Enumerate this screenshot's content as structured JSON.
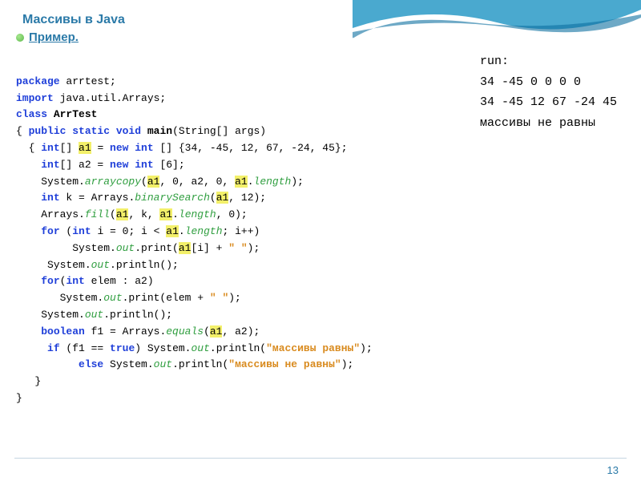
{
  "title": "Массивы в Java",
  "subtitle": "Пример.",
  "output": {
    "l1": "run:",
    "l2": "34 -45 0 0 0 0",
    "l3": "34 -45 12 67 -24 45",
    "l4": "массивы не равны"
  },
  "code": {
    "l01a": "package",
    "l01b": " arrtest;",
    "l02a": "import",
    "l02b": " java.util.Arrays;",
    "l03a": "class ",
    "l03b": "ArrTest",
    "l04a": "{ ",
    "l04b": "public static void",
    "l04c": " ",
    "l04d": "main",
    "l04e": "(String[] args)",
    "l05a": "  { ",
    "l05b": "int",
    "l05c": "[] ",
    "l05d": "a1",
    "l05e": " = ",
    "l05f": "new int",
    "l05g": " [] {34, -45, 12, 67, -24, 45};",
    "l06a": "    ",
    "l06b": "int",
    "l06c": "[] a2 = ",
    "l06d": "new int",
    "l06e": " [6];",
    "l07a": "    System.",
    "l07b": "arraycopy",
    "l07c": "(",
    "l07d": "a1",
    "l07e": ", 0, a2, 0, ",
    "l07f": "a1",
    "l07g": ".",
    "l07h": "length",
    "l07i": ");",
    "l08a": "    ",
    "l08b": "int",
    "l08c": " k = Arrays.",
    "l08d": "binarySearch",
    "l08e": "(",
    "l08f": "a1",
    "l08g": ", 12);",
    "l09a": "    Arrays.",
    "l09b": "fill",
    "l09c": "(",
    "l09d": "a1",
    "l09e": ", k, ",
    "l09f": "a1",
    "l09g": ".",
    "l09h": "length",
    "l09i": ", 0);",
    "l10a": "    ",
    "l10b": "for",
    "l10c": " (",
    "l10d": "int",
    "l10e": " i = 0; i < ",
    "l10f": "a1",
    "l10g": ".",
    "l10h": "length",
    "l10i": "; i++)",
    "l11a": "         System.",
    "l11b": "out",
    "l11c": ".print(",
    "l11d": "a1",
    "l11e": "[i] + ",
    "l11f": "\" \"",
    "l11g": ");",
    "l12a": "     System.",
    "l12b": "out",
    "l12c": ".println();",
    "l13a": "    ",
    "l13b": "for",
    "l13c": "(",
    "l13d": "int",
    "l13e": " elem : a2)",
    "l14a": "       System.",
    "l14b": "out",
    "l14c": ".print(elem + ",
    "l14d": "\" \"",
    "l14e": ");",
    "l15a": "    System.",
    "l15b": "out",
    "l15c": ".println();",
    "l16a": "    ",
    "l16b": "boolean",
    "l16c": " f1 = Arrays.",
    "l16d": "equals",
    "l16e": "(",
    "l16f": "a1",
    "l16g": ", a2);",
    "l17a": "     ",
    "l17b": "if",
    "l17c": " (f1 == ",
    "l17d": "true",
    "l17e": ") System.",
    "l17f": "out",
    "l17g": ".println(",
    "l17h": "\"массивы равны\"",
    "l17i": ");",
    "l18a": "          ",
    "l18b": "else",
    "l18c": " System.",
    "l18d": "out",
    "l18e": ".println(",
    "l18f": "\"массивы не равны\"",
    "l18g": ");",
    "l19": "   }",
    "l20": "}"
  },
  "pagenum": "13"
}
